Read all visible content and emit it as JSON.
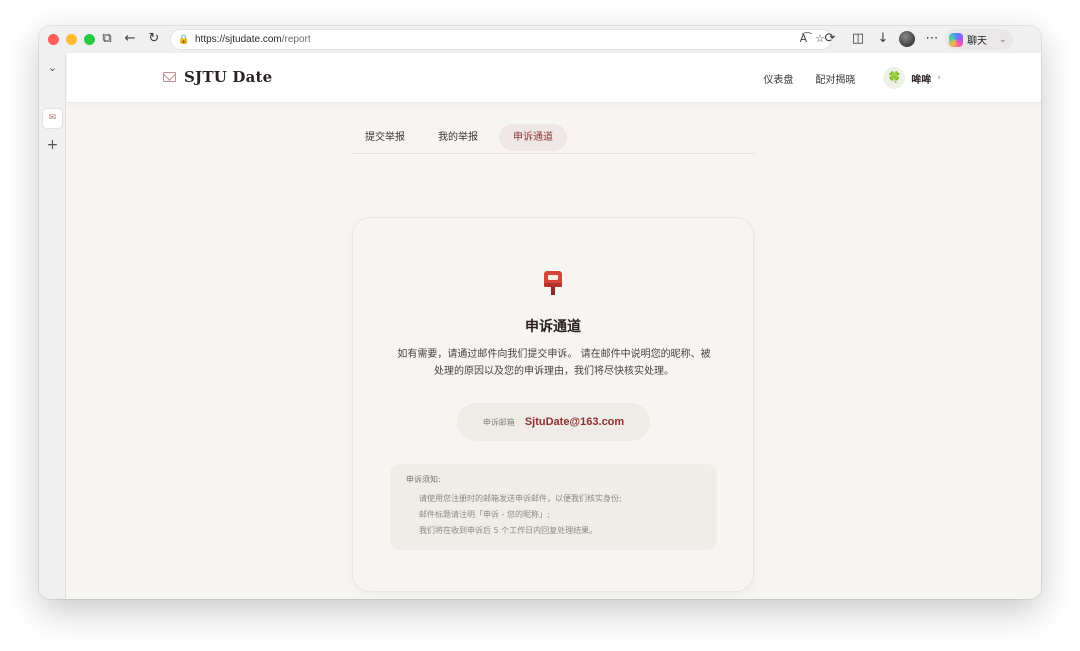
{
  "browser": {
    "url_host": "https://sjtudate.com",
    "url_path": "/report",
    "chat_label": "聊天"
  },
  "site": {
    "brand": "SJTU Date",
    "nav": {
      "dashboard": "仪表盘",
      "match_reveal": "配对揭晓",
      "user_name": "哞哞",
      "user_avatar": "🍀"
    }
  },
  "tabs": [
    {
      "label": "提交举报",
      "active": false
    },
    {
      "label": "我的举报",
      "active": false
    },
    {
      "label": "申诉通道",
      "active": true
    }
  ],
  "appeal": {
    "icon": "postbox-icon",
    "title": "申诉通道",
    "description_line1": "如有需要，请通过邮件向我们提交申诉。 请在邮件中说明您的昵称、被",
    "description_line2": "处理的原因以及您的申诉理由，我们将尽快核实处理。",
    "email_label": "申诉邮箱",
    "email": "SjtuDate@163.com",
    "notice": {
      "title": "申诉须知:",
      "items": [
        "请使用您注册时的邮箱发送申诉邮件，以便我们核实身份;",
        "邮件标题请注明「申诉 - 您的昵称」;",
        "我们将在收到申诉后 5 个工作日内回复处理结果。"
      ]
    }
  },
  "colors": {
    "accent": "#8b3131",
    "tab_active_bg": "#efe7e5",
    "page_bg": "#f7f5f2"
  }
}
